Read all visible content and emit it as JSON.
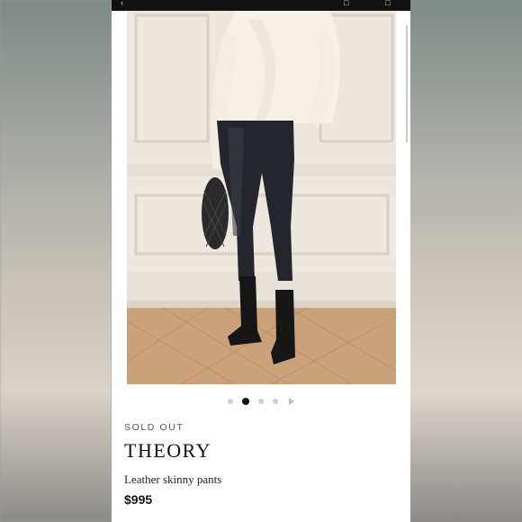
{
  "product": {
    "status": "SOLD OUT",
    "brand": "THEORY",
    "name": "Leather skinny pants",
    "price": "$995"
  },
  "gallery": {
    "slide_count": 4,
    "active_slide": 2
  },
  "icons": [
    "back-icon",
    "share-icon",
    "bag-icon",
    "next-slide-icon"
  ]
}
